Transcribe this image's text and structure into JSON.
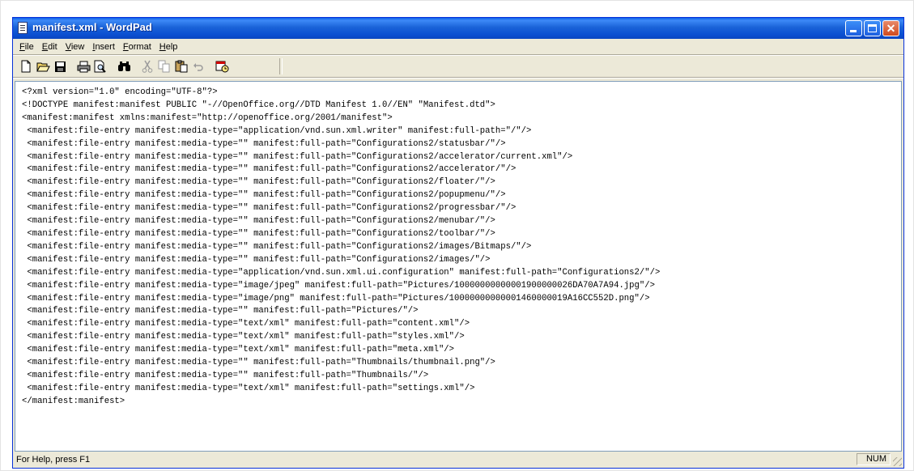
{
  "window": {
    "title": "manifest.xml - WordPad"
  },
  "menu": [
    "File",
    "Edit",
    "View",
    "Insert",
    "Format",
    "Help"
  ],
  "toolbar": {
    "icons": [
      "new-icon",
      "open-icon",
      "save-icon",
      "print-icon",
      "print-preview-icon",
      "find-icon",
      "cut-icon",
      "copy-icon",
      "paste-icon",
      "undo-icon",
      "date-time-icon"
    ]
  },
  "document": {
    "lines": [
      "<?xml version=\"1.0\" encoding=\"UTF-8\"?>",
      "<!DOCTYPE manifest:manifest PUBLIC \"-//OpenOffice.org//DTD Manifest 1.0//EN\" \"Manifest.dtd\">",
      "<manifest:manifest xmlns:manifest=\"http://openoffice.org/2001/manifest\">",
      " <manifest:file-entry manifest:media-type=\"application/vnd.sun.xml.writer\" manifest:full-path=\"/\"/>",
      " <manifest:file-entry manifest:media-type=\"\" manifest:full-path=\"Configurations2/statusbar/\"/>",
      " <manifest:file-entry manifest:media-type=\"\" manifest:full-path=\"Configurations2/accelerator/current.xml\"/>",
      " <manifest:file-entry manifest:media-type=\"\" manifest:full-path=\"Configurations2/accelerator/\"/>",
      " <manifest:file-entry manifest:media-type=\"\" manifest:full-path=\"Configurations2/floater/\"/>",
      " <manifest:file-entry manifest:media-type=\"\" manifest:full-path=\"Configurations2/popupmenu/\"/>",
      " <manifest:file-entry manifest:media-type=\"\" manifest:full-path=\"Configurations2/progressbar/\"/>",
      " <manifest:file-entry manifest:media-type=\"\" manifest:full-path=\"Configurations2/menubar/\"/>",
      " <manifest:file-entry manifest:media-type=\"\" manifest:full-path=\"Configurations2/toolbar/\"/>",
      " <manifest:file-entry manifest:media-type=\"\" manifest:full-path=\"Configurations2/images/Bitmaps/\"/>",
      " <manifest:file-entry manifest:media-type=\"\" manifest:full-path=\"Configurations2/images/\"/>",
      " <manifest:file-entry manifest:media-type=\"application/vnd.sun.xml.ui.configuration\" manifest:full-path=\"Configurations2/\"/>",
      " <manifest:file-entry manifest:media-type=\"image/jpeg\" manifest:full-path=\"Pictures/10000000000001900000026DA70A7A94.jpg\"/>",
      " <manifest:file-entry manifest:media-type=\"image/png\" manifest:full-path=\"Pictures/10000000000001460000019A16CC552D.png\"/>",
      " <manifest:file-entry manifest:media-type=\"\" manifest:full-path=\"Pictures/\"/>",
      " <manifest:file-entry manifest:media-type=\"text/xml\" manifest:full-path=\"content.xml\"/>",
      " <manifest:file-entry manifest:media-type=\"text/xml\" manifest:full-path=\"styles.xml\"/>",
      " <manifest:file-entry manifest:media-type=\"text/xml\" manifest:full-path=\"meta.xml\"/>",
      " <manifest:file-entry manifest:media-type=\"\" manifest:full-path=\"Thumbnails/thumbnail.png\"/>",
      " <manifest:file-entry manifest:media-type=\"\" manifest:full-path=\"Thumbnails/\"/>",
      " <manifest:file-entry manifest:media-type=\"text/xml\" manifest:full-path=\"settings.xml\"/>",
      "</manifest:manifest>"
    ]
  },
  "status": {
    "help": "For Help, press F1",
    "num": "NUM"
  },
  "colors": {
    "titlebar": "#0b4fd1",
    "chrome": "#ece9d8",
    "close": "#d04a1e"
  }
}
